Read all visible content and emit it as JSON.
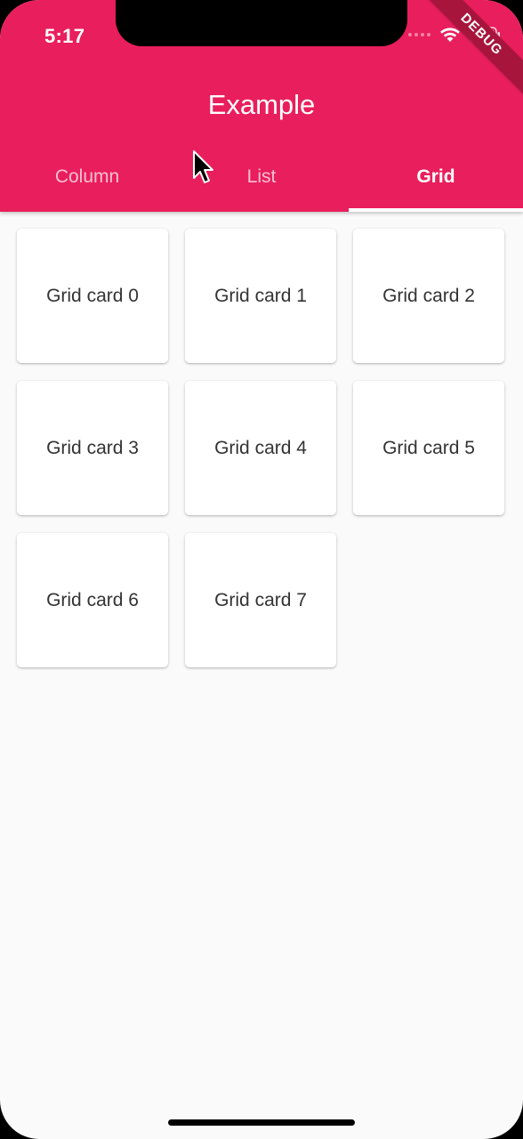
{
  "status_bar": {
    "time": "5:17"
  },
  "app_bar": {
    "title": "Example",
    "color": "#e91e5c"
  },
  "debug_banner": {
    "label": "DEBUG"
  },
  "tabs": [
    {
      "label": "Column",
      "active": false
    },
    {
      "label": "List",
      "active": false
    },
    {
      "label": "Grid",
      "active": true
    }
  ],
  "grid": {
    "cards": [
      "Grid card 0",
      "Grid card 1",
      "Grid card 2",
      "Grid card 3",
      "Grid card 4",
      "Grid card 5",
      "Grid card 6",
      "Grid card 7"
    ]
  },
  "icons": {
    "wifi": "wifi-icon",
    "battery": "battery-icon",
    "cursor": "mouse-pointer-icon"
  }
}
